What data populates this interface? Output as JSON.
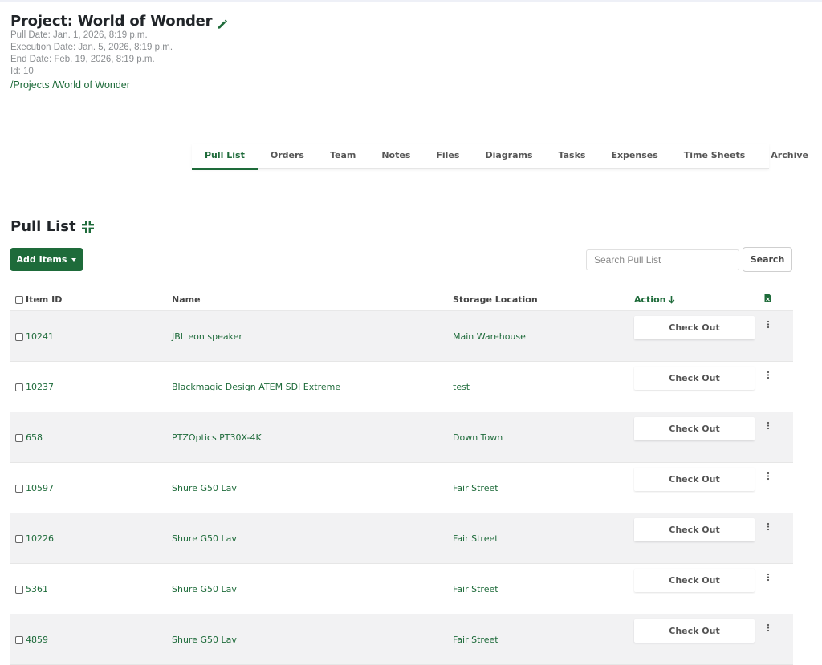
{
  "project": {
    "title": "Project: World of Wonder",
    "pull_date": "Pull Date: Jan. 1, 2026, 8:19 p.m.",
    "execution_date": "Execution Date: Jan. 5, 2026, 8:19 p.m.",
    "end_date": "End Date: Feb. 19, 2026, 8:19 p.m.",
    "id": "Id: 10",
    "breadcrumb": [
      "/Projects",
      "/World of Wonder"
    ]
  },
  "tabs": [
    {
      "label": "Pull List",
      "active": true
    },
    {
      "label": "Orders"
    },
    {
      "label": "Team"
    },
    {
      "label": "Notes"
    },
    {
      "label": "Files"
    },
    {
      "label": "Diagrams"
    },
    {
      "label": "Tasks"
    },
    {
      "label": "Expenses"
    },
    {
      "label": "Time Sheets"
    },
    {
      "label": "Archive"
    }
  ],
  "pull_list": {
    "title": "Pull List",
    "add_items_label": "Add Items",
    "search_placeholder": "Search Pull List",
    "search_button": "Search",
    "columns": {
      "item_id": "Item ID",
      "name": "Name",
      "storage_location": "Storage Location",
      "action": "Action"
    },
    "checkout_label": "Check Out",
    "rows": [
      {
        "id": "10241",
        "name": "JBL eon speaker",
        "location": "Main Warehouse"
      },
      {
        "id": "10237",
        "name": "Blackmagic Design ATEM SDI Extreme",
        "location": "test"
      },
      {
        "id": "658",
        "name": "PTZOptics PT30X-4K",
        "location": "Down Town"
      },
      {
        "id": "10597",
        "name": "Shure G50 Lav",
        "location": "Fair Street"
      },
      {
        "id": "10226",
        "name": "Shure G50 Lav",
        "location": "Fair Street"
      },
      {
        "id": "5361",
        "name": "Shure G50 Lav",
        "location": "Fair Street"
      },
      {
        "id": "4859",
        "name": "Shure G50 Lav",
        "location": "Fair Street"
      }
    ]
  },
  "colors": {
    "accent": "#1e6b3a",
    "row_alt": "#f2f2f3"
  },
  "icons": [
    "pencil-icon",
    "compress-icon",
    "caret-down-icon",
    "arrow-down-icon",
    "file-excel-icon",
    "kebab-menu-icon",
    "checkbox-icon"
  ]
}
